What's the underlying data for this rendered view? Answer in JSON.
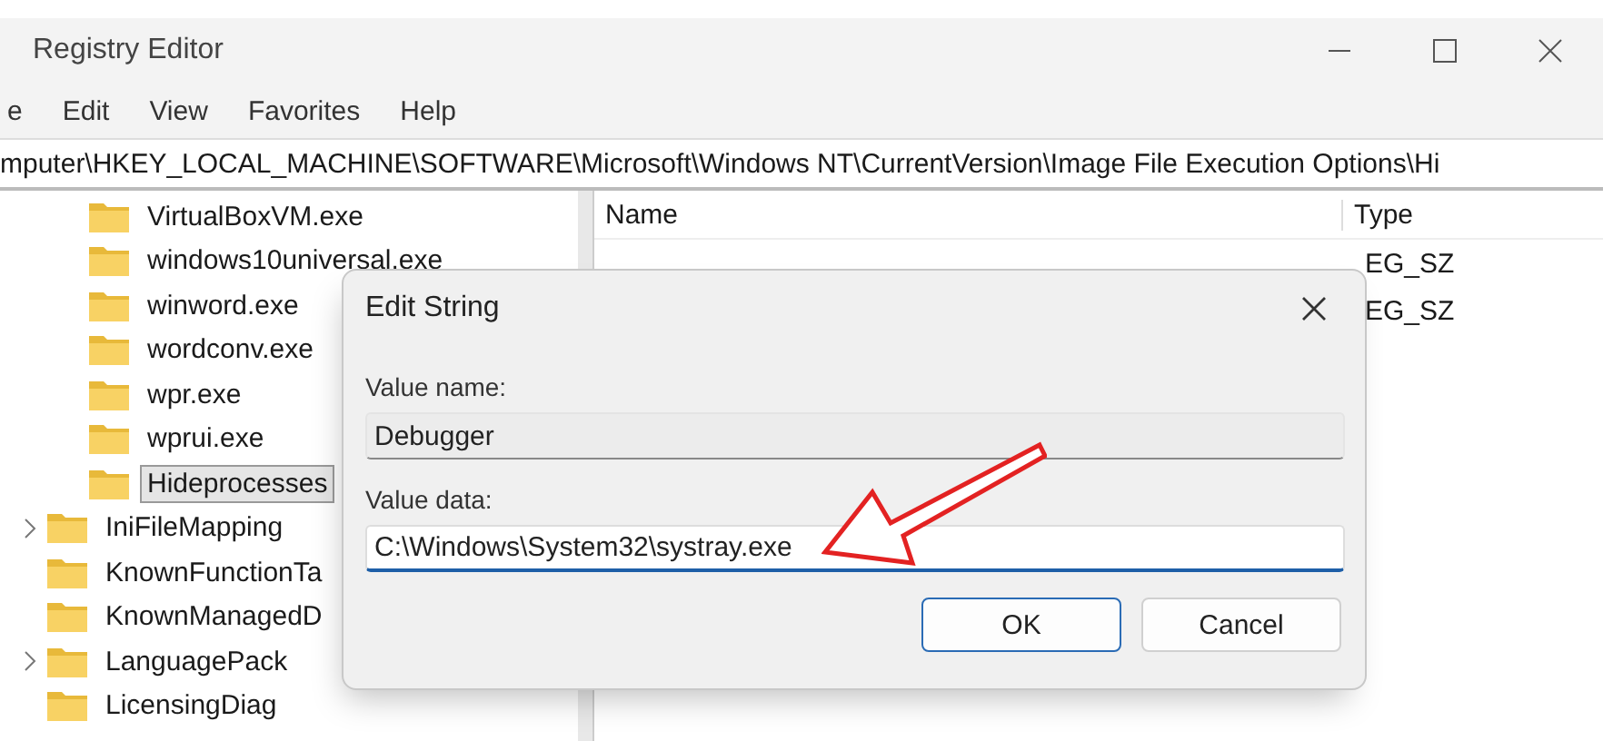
{
  "window": {
    "title": "Registry Editor"
  },
  "menu": [
    "e",
    "Edit",
    "View",
    "Favorites",
    "Help"
  ],
  "address": "mputer\\HKEY_LOCAL_MACHINE\\SOFTWARE\\Microsoft\\Windows NT\\CurrentVersion\\Image File Execution Options\\Hi",
  "tree": [
    {
      "kind": "group",
      "children": [
        {
          "label": "VirtualBoxVM.exe",
          "selected": false
        },
        {
          "label": "windows10universal.exe",
          "selected": false
        },
        {
          "label": "winword.exe",
          "selected": false
        },
        {
          "label": "wordconv.exe",
          "selected": false
        },
        {
          "label": "wpr.exe",
          "selected": false
        },
        {
          "label": "wprui.exe",
          "selected": false
        },
        {
          "label": "Hideprocesses",
          "selected": true
        }
      ]
    },
    {
      "kind": "expandable",
      "label": "IniFileMapping",
      "selected": false
    },
    {
      "kind": "leaf",
      "label": "KnownFunctionTa",
      "selected": false
    },
    {
      "kind": "leaf",
      "label": "KnownManagedD",
      "selected": false
    },
    {
      "kind": "expandable",
      "label": "LanguagePack",
      "selected": false
    },
    {
      "kind": "leaf",
      "label": "LicensingDiag",
      "selected": false
    }
  ],
  "list": {
    "columns": [
      "Name",
      "Type"
    ],
    "rows": [
      {
        "type": "EG_SZ"
      },
      {
        "type": "EG_SZ"
      }
    ]
  },
  "dialog": {
    "title": "Edit String",
    "fields": [
      {
        "label": "Value name:",
        "value": "Debugger",
        "disabled": true
      },
      {
        "label": "Value data:",
        "value": "C:\\Windows\\System32\\systray.exe",
        "disabled": false
      }
    ],
    "buttons": [
      {
        "label": "OK",
        "default": true
      },
      {
        "label": "Cancel",
        "default": false
      }
    ],
    "annotation": {
      "kind": "arrow"
    }
  }
}
